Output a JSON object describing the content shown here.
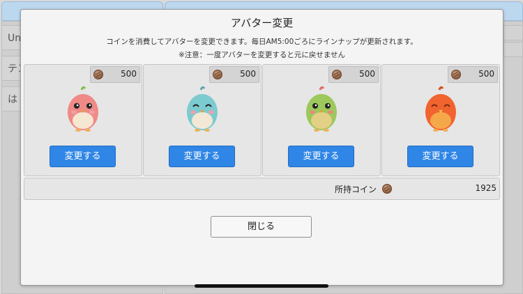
{
  "background": {
    "left_items": [
      "Uni",
      "テン",
      "は"
    ]
  },
  "modal": {
    "title": "アバター変更",
    "description": "コインを消費してアバターを変更できます。毎日AM5:00ごろにラインナップが更新されます。",
    "warning": "※注意：一度アバターを変更すると元に戻せません",
    "coin_icon": "coin-icon",
    "cards": [
      {
        "price": "500",
        "button_label": "変更する",
        "avatar_color": "#ef8a86",
        "avatar_belly": "#f6e7d3",
        "avatar_eye": "round"
      },
      {
        "price": "500",
        "button_label": "変更する",
        "avatar_color": "#7ccbd0",
        "avatar_belly": "#f3e7d6",
        "avatar_eye": "closed"
      },
      {
        "price": "500",
        "button_label": "変更する",
        "avatar_color": "#9cc85c",
        "avatar_belly": "#e4cf86",
        "avatar_eye": "round"
      },
      {
        "price": "500",
        "button_label": "変更する",
        "avatar_color": "#f1642f",
        "avatar_belly": "#f5a84a",
        "avatar_eye": "closed"
      }
    ],
    "owned": {
      "label": "所持コイン",
      "value": "1925"
    },
    "close_label": "閉じる"
  },
  "colors": {
    "primary_button": "#2f86e6",
    "modal_bg": "#f4f4f4",
    "card_bg": "#e6e6e6"
  }
}
